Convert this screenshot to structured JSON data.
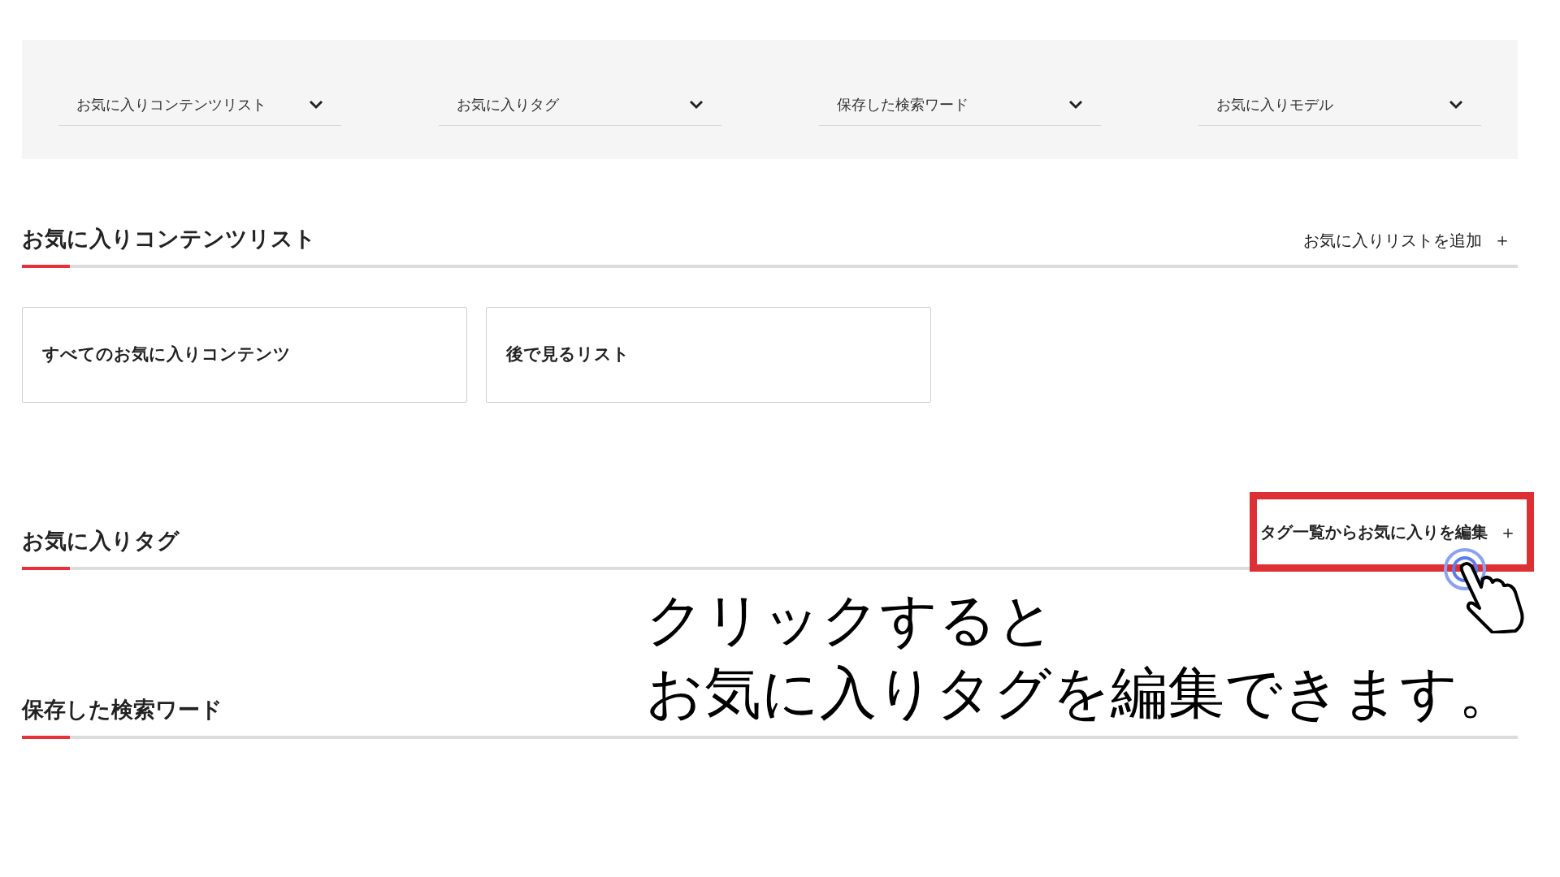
{
  "filter_bar": {
    "dropdowns": [
      {
        "label": "お気に入りコンテンツリスト"
      },
      {
        "label": "お気に入りタグ"
      },
      {
        "label": "保存した検索ワード"
      },
      {
        "label": "お気に入りモデル"
      }
    ]
  },
  "sections": [
    {
      "title": "お気に入りコンテンツリスト",
      "action": {
        "label": "お気に入りリストを追加",
        "icon": "＋",
        "highlighted": false
      },
      "cards": [
        "すべてのお気に入りコンテンツ",
        "後で見るリスト"
      ]
    },
    {
      "title": "お気に入りタグ",
      "action": {
        "label": "タグ一覧からお気に入りを編集",
        "icon": "＋",
        "highlighted": true
      }
    },
    {
      "title": "保存した検索ワード"
    }
  ],
  "annotation": {
    "lines": [
      "クリックすると",
      "お気に入りタグを編集できます。"
    ]
  }
}
